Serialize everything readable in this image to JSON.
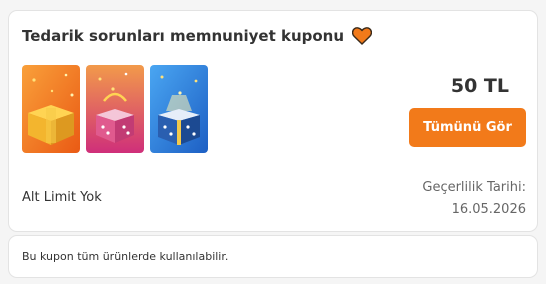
{
  "coupon": {
    "title": "Tedarik sorunları memnuniyet kuponu",
    "heart_icon": "heart-icon",
    "amount": "50 TL",
    "view_all_label": "Tümünü Gör",
    "limit_text": "Alt Limit Yok",
    "validity_label": "Geçerlilik Tarihi:",
    "validity_date": "16.05.2026",
    "images": [
      {
        "name": "gold-gift-box-image",
        "bg": "#f57a1f"
      },
      {
        "name": "pink-gift-box-image",
        "bg": "#d63c78"
      },
      {
        "name": "blue-gift-box-image",
        "bg": "#2f86e0"
      }
    ]
  },
  "note": {
    "text": "Bu kupon tüm ürünlerde kullanılabilir."
  },
  "colors": {
    "accent": "#f27a1a",
    "heart": "#f27a1a",
    "text_dark": "#333333",
    "text_muted": "#666666"
  }
}
